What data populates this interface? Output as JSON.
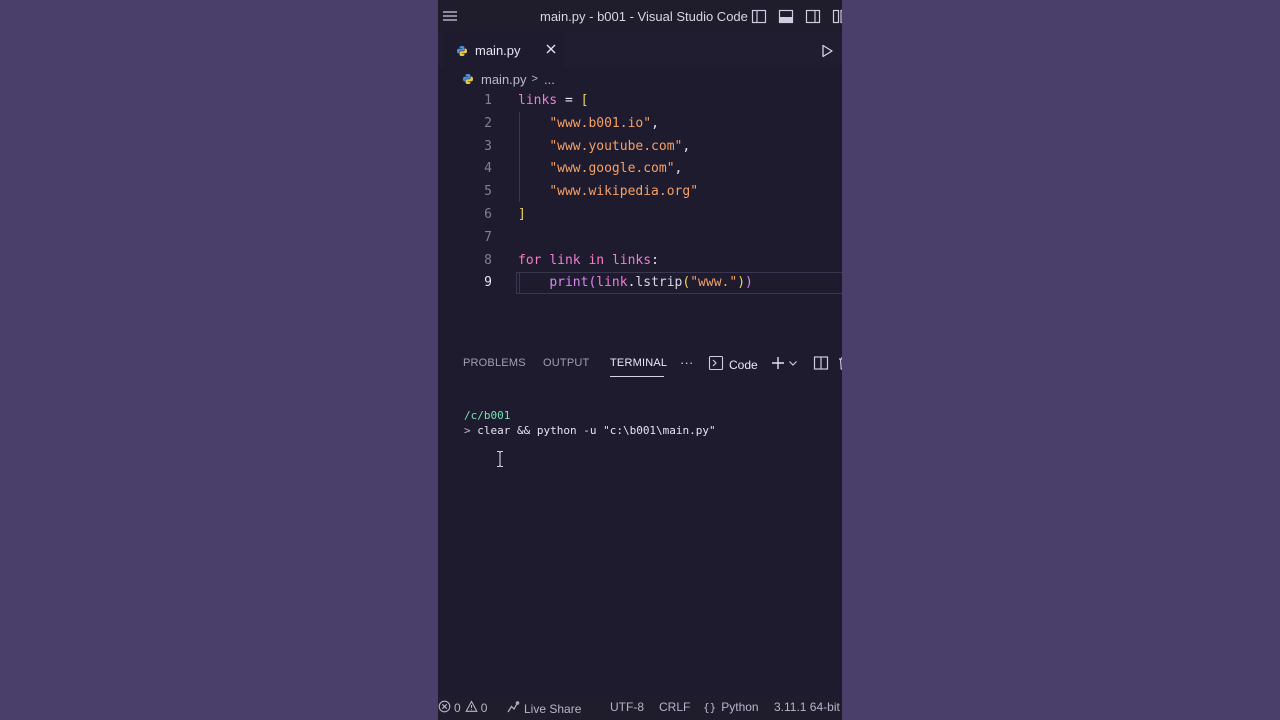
{
  "window": {
    "title": "main.py - b001 - Visual Studio Code"
  },
  "tabs": [
    {
      "label": "main.py",
      "active": true
    }
  ],
  "breadcrumb": {
    "file": "main.py",
    "separator": ">",
    "more": "..."
  },
  "editor": {
    "lines": [
      {
        "num": "1",
        "tokens": [
          [
            "var",
            "links"
          ],
          [
            "op",
            " = "
          ],
          [
            "br",
            "["
          ]
        ]
      },
      {
        "num": "2",
        "tokens": [
          [
            "op",
            "    "
          ],
          [
            "str",
            "\"www.b001.io\""
          ],
          [
            "op",
            ","
          ]
        ]
      },
      {
        "num": "3",
        "tokens": [
          [
            "op",
            "    "
          ],
          [
            "str",
            "\"www.youtube.com\""
          ],
          [
            "op",
            ","
          ]
        ]
      },
      {
        "num": "4",
        "tokens": [
          [
            "op",
            "    "
          ],
          [
            "str",
            "\"www.google.com\""
          ],
          [
            "op",
            ","
          ]
        ]
      },
      {
        "num": "5",
        "tokens": [
          [
            "op",
            "    "
          ],
          [
            "str",
            "\"www.wikipedia.org\""
          ]
        ]
      },
      {
        "num": "6",
        "tokens": [
          [
            "br",
            "]"
          ]
        ]
      },
      {
        "num": "7",
        "tokens": []
      },
      {
        "num": "8",
        "tokens": [
          [
            "kw",
            "for"
          ],
          [
            "op",
            " "
          ],
          [
            "var",
            "link"
          ],
          [
            "op",
            " "
          ],
          [
            "kw",
            "in"
          ],
          [
            "op",
            " "
          ],
          [
            "var",
            "links"
          ],
          [
            "op",
            ":"
          ]
        ]
      },
      {
        "num": "9",
        "tokens": [
          [
            "op",
            "    "
          ],
          [
            "fn",
            "print"
          ],
          [
            "br2",
            "("
          ],
          [
            "var",
            "link"
          ],
          [
            "op",
            "."
          ],
          [
            "fnp",
            "lstrip"
          ],
          [
            "br",
            "("
          ],
          [
            "str",
            "\"www.\""
          ],
          [
            "br",
            ")"
          ],
          [
            "br2",
            ")"
          ]
        ]
      }
    ],
    "active_line": "9"
  },
  "panel": {
    "tabs": [
      "PROBLEMS",
      "OUTPUT",
      "TERMINAL"
    ],
    "active_tab": "TERMINAL",
    "more": "···",
    "terminal_name": "Code"
  },
  "terminal": {
    "path": "/c/b001",
    "prompt": ">",
    "command": "clear && python -u \"c:\\b001\\main.py\""
  },
  "statusbar": {
    "errors": "0",
    "warnings": "0",
    "live_share": "Live Share",
    "encoding": "UTF-8",
    "eol": "CRLF",
    "language": "Python",
    "interpreter": "3.11.1 64-bit"
  },
  "colors": {
    "background": "#4b3f6b",
    "editor_bg": "#1e1b2e",
    "string": "#f5a066",
    "keyword": "#ff79c6",
    "bracket": "#f2d35a",
    "terminal_path": "#7ce0b8"
  }
}
